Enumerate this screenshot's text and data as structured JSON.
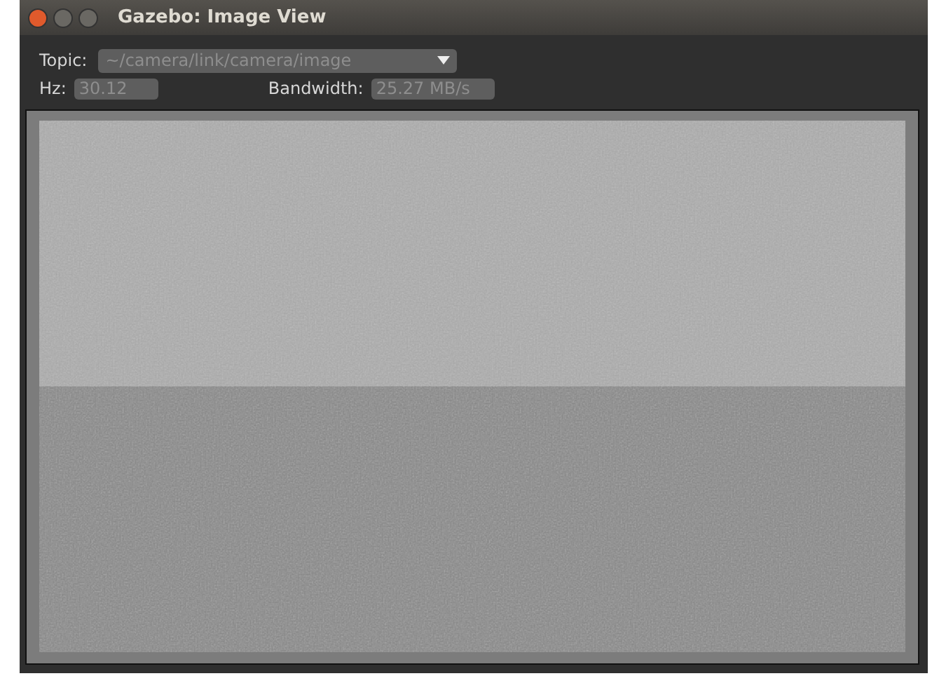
{
  "window": {
    "title": "Gazebo: Image View"
  },
  "topic": {
    "label": "Topic:",
    "value": "~/camera/link/camera/image"
  },
  "stats": [
    {
      "label": "Hz:",
      "value": "30.12"
    },
    {
      "label": "Bandwidth:",
      "value": "25.27 MB/s"
    }
  ]
}
